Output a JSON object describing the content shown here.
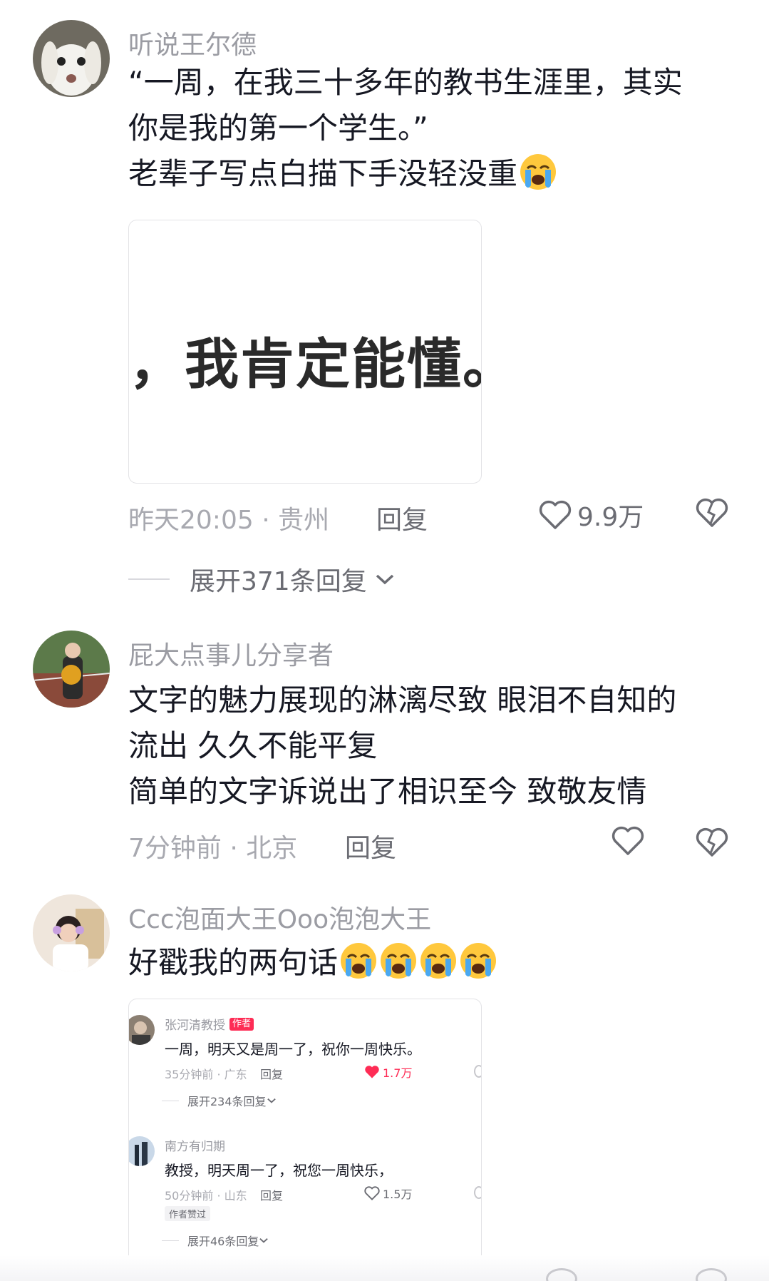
{
  "comments": [
    {
      "username": "听说王尔德",
      "text_lines": [
        "“一周，在我三十多年的教书生涯里，其实",
        "你是我的第一个学生。”",
        "老辈子写点白描下手没轻没重"
      ],
      "image_caption": "，我肯定能懂。",
      "time_location": "昨天20:05 · 贵州",
      "reply_label": "回复",
      "like_count": "9.9万",
      "expand_label": "展开371条回复"
    },
    {
      "username": "屁大点事儿分享者",
      "text_lines": [
        "文字的魅力展现的淋漓尽致 眼泪不自知的",
        "流出 久久不能平复",
        "简单的文字诉说出了相识至今   致敬友情"
      ],
      "time_location": "7分钟前 · 北京",
      "reply_label": "回复"
    },
    {
      "username": "Ccc泡面大王Ooo泡泡大王",
      "text_lines": [
        "好戳我的两句话"
      ],
      "time_location": "",
      "reply_label": ""
    }
  ],
  "embedded_screenshot": {
    "items": [
      {
        "username": "张河清教授",
        "author_tag": "作者",
        "text": "一周，明天又是周一了，祝你一周快乐。",
        "time_location": "35分钟前 · 广东",
        "reply_label": "回复",
        "like_count": "1.7万",
        "liked": true,
        "expand_label": "展开234条回复"
      },
      {
        "username": "南方有归期",
        "text": "教授，明天周一了，祝您一周快乐，",
        "time_location": "50分钟前 · 山东",
        "reply_label": "回复",
        "like_count": "1.5万",
        "liked": false,
        "badge": "作者赞过",
        "expand_label": "展开46条回复"
      }
    ]
  },
  "colors": {
    "accent_red": "#fe2c55",
    "text_primary": "#161823",
    "text_secondary": "#9b9ca3"
  },
  "icons": [
    "heart-outline-icon",
    "heart-broken-icon",
    "chevron-down-icon",
    "loudly-crying-emoji",
    "heart-filled-icon"
  ]
}
